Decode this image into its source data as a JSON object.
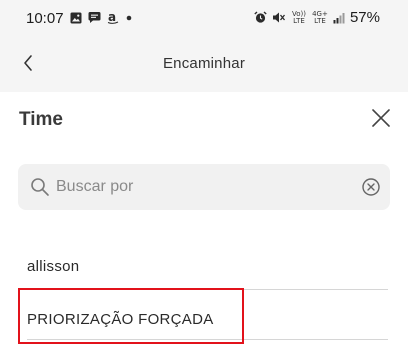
{
  "status_bar": {
    "time": "10:07",
    "left_icons": [
      "gallery-icon",
      "chat-bubble-icon",
      "amazon-icon",
      "dot-icon"
    ],
    "right_icons": [
      "alarm-icon",
      "mute-icon",
      "volte-icon",
      "4g-lte-icon",
      "signal-icon"
    ],
    "volte_text": "Vo)) LTE",
    "network_text": "4G+ LTE",
    "battery": "57%"
  },
  "app_bar": {
    "back_icon": "chevron-left-icon",
    "title": "Encaminhar"
  },
  "sheet": {
    "title": "Time",
    "close_icon": "close-icon",
    "search": {
      "placeholder": "Buscar por",
      "value": "",
      "search_icon": "search-icon",
      "clear_icon": "clear-circle-icon"
    },
    "items": [
      {
        "label": "allisson"
      },
      {
        "label": "PRIORIZAÇÃO FORÇADA"
      }
    ]
  },
  "colors": {
    "highlight_border": "#e2121b",
    "bar_background": "#f5f5f5",
    "search_background": "#f1f1f1"
  }
}
